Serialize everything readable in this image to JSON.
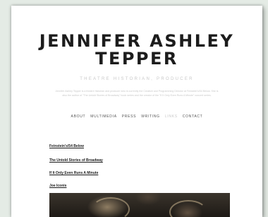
{
  "site": {
    "title_line1": "JENNIFER ASHLEY",
    "title_line2": "TEPPER",
    "subtitle": "THEATRE HISTORIAN, PRODUCER",
    "bio": "Jennifer Ashley Tepper is a theatre historian and producer who is currently the Creative and Programming Director at Feinstein's/54 Below. She is also the author of \"The Untold Stories of Broadway\" book series and the creator of the \"If It Only Even Runs A Minute\" concert series."
  },
  "nav": {
    "items": [
      {
        "label": "ABOUT"
      },
      {
        "label": "MULTIMEDIA"
      },
      {
        "label": "PRESS"
      },
      {
        "label": "WRITING"
      },
      {
        "label": "LINKS",
        "active": true
      },
      {
        "label": "CONTACT"
      }
    ]
  },
  "links": [
    {
      "label": "Feinstein's/54 Below"
    },
    {
      "label": "The Untold Stories of Broadway"
    },
    {
      "label": "If It Only Even Runs A Minute"
    },
    {
      "label": "Joe Iconis"
    }
  ]
}
